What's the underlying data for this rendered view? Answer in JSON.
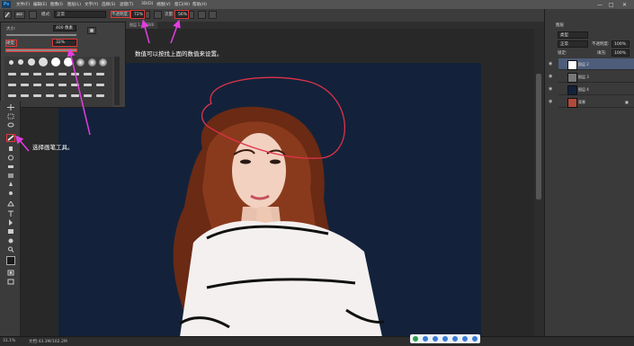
{
  "app": {
    "logo": "Ps"
  },
  "menu": [
    "文件(F)",
    "编辑(E)",
    "图像(I)",
    "图层(L)",
    "文字(Y)",
    "选择(S)",
    "滤镜(T)",
    "3D(D)",
    "视图(V)",
    "窗口(W)",
    "帮助(H)"
  ],
  "window_controls": [
    "—",
    "□",
    "✕"
  ],
  "options": {
    "mode_label": "模式:",
    "mode_value": "正常",
    "opacity_label": "不透明度:",
    "opacity_value": "72%",
    "flow_label": "流量:",
    "flow_value": "56%",
    "brush_size_badge": "400"
  },
  "tab": {
    "label": "图层 1, RGB/8"
  },
  "brush_panel": {
    "size_label": "大小:",
    "size_value": "400 像素",
    "hardness_label": "硬度:",
    "hardness_value": "32%"
  },
  "annotations": {
    "top": "数值可以按找上面的数值来设置。",
    "left": "选择画笔工具。"
  },
  "right_panel": {
    "workspace": "基本功能",
    "tab_layers": "图层",
    "kind_filter": "类型",
    "blend_mode": "正常",
    "opacity_label": "不透明度:",
    "opacity_value": "100%",
    "lock_label": "锁定:",
    "fill_label": "填充:",
    "fill_value": "100%",
    "layers": [
      {
        "name": "图层 2"
      },
      {
        "name": "图层 3"
      },
      {
        "name": "图层 4"
      },
      {
        "name": "背景"
      }
    ]
  },
  "status": {
    "zoom": "31.1%",
    "doc": "文档:43.3M/102.2M"
  },
  "colors": {
    "accent_arrow": "#e23ee0",
    "highlight_circle": "#e0324a",
    "canvas_bg": "#13223a"
  },
  "icons": {
    "brush_tool": "brush-icon",
    "eye": "eye-icon",
    "lock": "lock-icon"
  }
}
